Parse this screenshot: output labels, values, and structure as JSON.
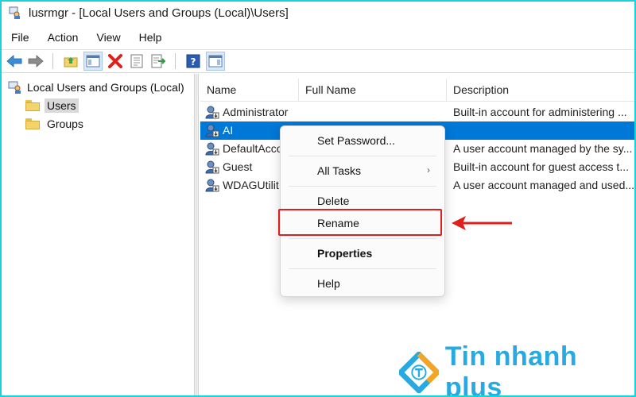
{
  "window": {
    "title": "lusrmgr - [Local Users and Groups (Local)\\Users]"
  },
  "menu": [
    "File",
    "Action",
    "View",
    "Help"
  ],
  "toolbar": {
    "icons": [
      "back-icon",
      "forward-icon",
      "up-folder-icon",
      "show-hide-tree-icon",
      "delete-icon",
      "properties-icon",
      "export-list-icon",
      "help-icon",
      "action-pane-icon"
    ]
  },
  "tree": {
    "root": "Local Users and Groups (Local)",
    "items": [
      {
        "label": "Users",
        "selected": true
      },
      {
        "label": "Groups",
        "selected": false
      }
    ]
  },
  "list": {
    "columns": [
      "Name",
      "Full Name",
      "Description"
    ],
    "rows": [
      {
        "name": "Administrator",
        "full_name": "",
        "description": "Built-in account for administering ...",
        "selected": false
      },
      {
        "name": "AI",
        "full_name": "",
        "description": "",
        "selected": true
      },
      {
        "name": "DefaultAcco",
        "full_name": "",
        "description": "A user account managed by the sy...",
        "selected": false
      },
      {
        "name": "Guest",
        "full_name": "",
        "description": "Built-in account for guest access t...",
        "selected": false
      },
      {
        "name": "WDAGUtilit",
        "full_name": "",
        "description": "A user account managed and used...",
        "selected": false
      }
    ]
  },
  "context_menu": {
    "items": [
      {
        "label": "Set Password...",
        "bold": false,
        "submenu": false
      },
      {
        "label": "All Tasks",
        "bold": false,
        "submenu": true
      },
      {
        "label": "Delete",
        "bold": false,
        "submenu": false
      },
      {
        "label": "Rename",
        "bold": false,
        "submenu": false,
        "highlighted": true
      },
      {
        "label": "Properties",
        "bold": true,
        "submenu": false
      },
      {
        "label": "Help",
        "bold": false,
        "submenu": false
      }
    ],
    "submenu_arrow": "›"
  },
  "watermark": {
    "text": "Tin nhanh plus",
    "color": "#27a9e1"
  },
  "colors": {
    "selection": "#0078d7",
    "highlight": "#e01e1e",
    "frame": "#19d3d8"
  }
}
